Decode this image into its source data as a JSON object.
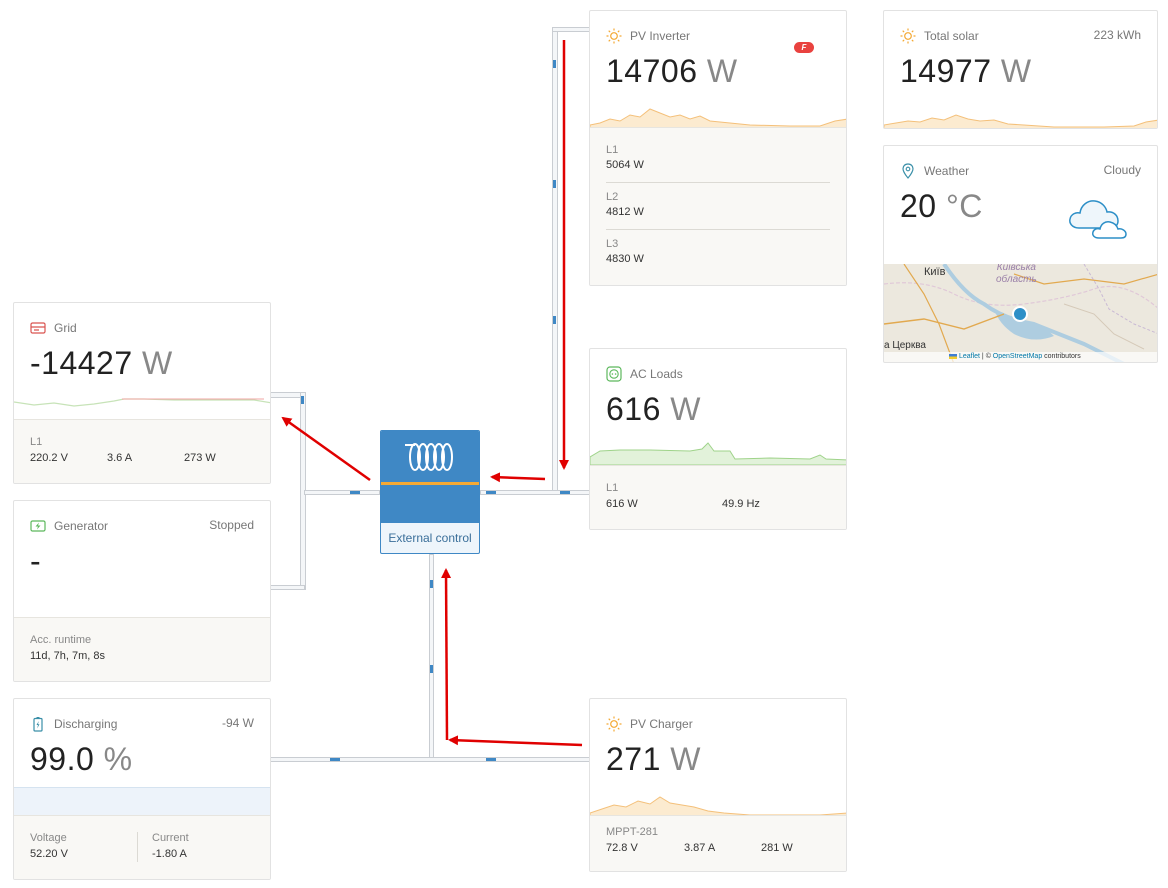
{
  "pv_inverter": {
    "title": "PV Inverter",
    "value": "14706",
    "unit": "W",
    "phases": [
      {
        "label": "L1",
        "value": "5064 W"
      },
      {
        "label": "L2",
        "value": "4812 W"
      },
      {
        "label": "L3",
        "value": "4830 W"
      }
    ]
  },
  "total_solar": {
    "title": "Total solar",
    "energy": "223 kWh",
    "value": "14977",
    "unit": "W"
  },
  "weather": {
    "title": "Weather",
    "condition": "Cloudy",
    "value": "20",
    "unit": "°C",
    "map": {
      "city": "Київ",
      "region": "Київська\nобласть",
      "town": "а Церква",
      "attribution_leaflet": "Leaflet",
      "attribution_sep": " | © ",
      "attribution_osm": "OpenStreetMap",
      "attribution_tail": " contributors"
    }
  },
  "grid": {
    "title": "Grid",
    "value": "-14427",
    "unit": "W",
    "phase": "L1",
    "voltage": "220.2 V",
    "current": "3.6 A",
    "power": "273 W"
  },
  "ac_loads": {
    "title": "AC Loads",
    "value": "616",
    "unit": "W",
    "phase": "L1",
    "power": "616 W",
    "frequency": "49.9 Hz"
  },
  "hub": {
    "label": "External control"
  },
  "generator": {
    "title": "Generator",
    "status": "Stopped",
    "value": "-",
    "runtime_label": "Acc. runtime",
    "runtime_value": "11d, 7h, 7m, 8s"
  },
  "battery": {
    "title": "Discharging",
    "power": "-94 W",
    "value": "99.0",
    "unit": "%",
    "voltage_label": "Voltage",
    "voltage_value": "52.20 V",
    "current_label": "Current",
    "current_value": "-1.80 A"
  },
  "pv_charger": {
    "title": "PV Charger",
    "value": "271",
    "unit": "W",
    "device": "MPPT-281",
    "voltage": "72.8 V",
    "current": "3.87 A",
    "power": "281 W"
  },
  "colors": {
    "solar": "#f4a934",
    "grid": "#d9534f",
    "loads": "#5cb85c",
    "battery": "#3a8fa8",
    "accent": "#3f88c5",
    "arrow": "#e00000"
  }
}
